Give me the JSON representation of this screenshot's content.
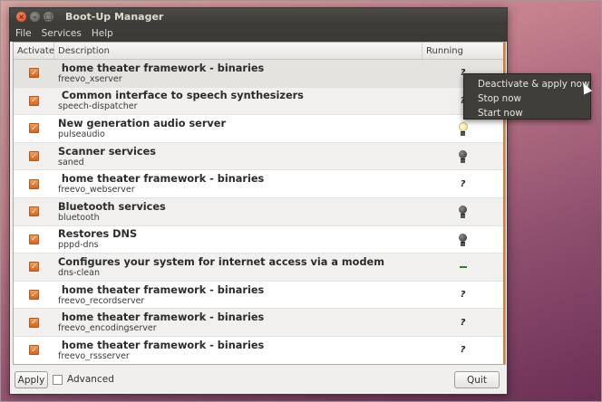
{
  "window": {
    "title": "Boot-Up Manager",
    "controls": {
      "close": "×",
      "minimize": "–",
      "maximize": "□"
    }
  },
  "menu": [
    "File",
    "Services",
    "Help"
  ],
  "columns": {
    "activate": "Activate",
    "description": "Description",
    "running": "Running"
  },
  "check_mark": "✓",
  "rows": [
    {
      "title": " home theater framework - binaries",
      "name": "freevo_xserver",
      "running": "?"
    },
    {
      "title": " Common interface to speech synthesizers",
      "name": "speech-dispatcher",
      "running": "?"
    },
    {
      "title": "New generation audio server",
      "name": "pulseaudio",
      "running": "bulb-on"
    },
    {
      "title": "Scanner services",
      "name": "saned",
      "running": "bulb-off"
    },
    {
      "title": " home theater framework - binaries",
      "name": "freevo_webserver",
      "running": "?"
    },
    {
      "title": "Bluetooth services",
      "name": "bluetooth",
      "running": "bulb-off"
    },
    {
      "title": "Restores DNS",
      "name": "pppd-dns",
      "running": "bulb-off"
    },
    {
      "title": "Configures your system for internet access via a modem",
      "name": "dns-clean",
      "running": "dash"
    },
    {
      "title": " home theater framework - binaries",
      "name": "freevo_recordserver",
      "running": "?"
    },
    {
      "title": " home theater framework - binaries",
      "name": "freevo_encodingserver",
      "running": "?"
    },
    {
      "title": " home theater framework - binaries",
      "name": "freevo_rssserver",
      "running": "?"
    }
  ],
  "footer": {
    "apply": "Apply",
    "advanced": "Advanced",
    "quit": "Quit"
  },
  "context_menu": [
    "Deactivate & apply now",
    "Stop now",
    "Start now"
  ],
  "colors": {
    "accent": "#dd4814",
    "checkbox": "#e8782e",
    "titlebar": "#3c3b37"
  }
}
